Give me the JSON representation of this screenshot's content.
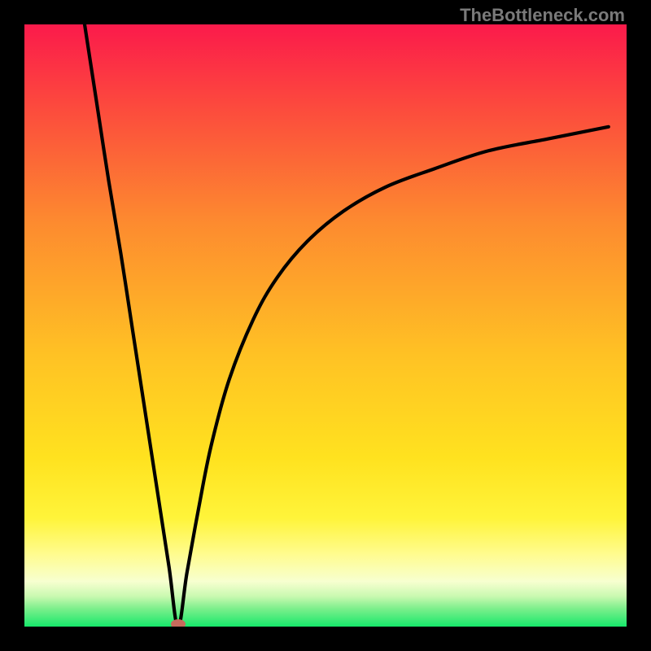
{
  "watermark": "TheBottleneck.com",
  "colors": {
    "top": "#fb1a4b",
    "mid_upper": "#fd8b2f",
    "mid": "#ffd21f",
    "mid_lower": "#fff960",
    "pale": "#faffc3",
    "green_light": "#9cf29c",
    "green": "#17e86b",
    "curve": "#000000",
    "dot": "#c76b5d",
    "background": "#000000"
  },
  "chart_data": {
    "type": "line",
    "title": "",
    "xlabel": "",
    "ylabel": "",
    "xlim": [
      0,
      100
    ],
    "ylim": [
      0,
      100
    ],
    "min_point": {
      "x": 25.5,
      "y": 0
    },
    "series": [
      {
        "name": "curve",
        "x": [
          10,
          12,
          14,
          16,
          18,
          20,
          22,
          24,
          25.5,
          27,
          29,
          31,
          34,
          38,
          42,
          47,
          53,
          60,
          68,
          77,
          87,
          97
        ],
        "y": [
          100,
          87,
          74,
          62,
          49,
          36,
          23,
          10,
          0,
          9,
          20,
          30,
          41,
          51,
          58,
          64,
          69,
          73,
          76,
          79,
          81,
          83
        ]
      }
    ],
    "annotations": []
  }
}
